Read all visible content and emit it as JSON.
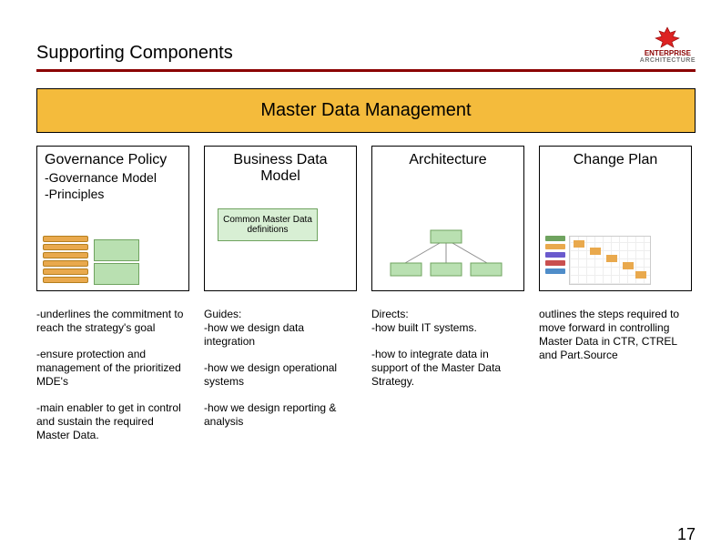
{
  "header": {
    "title": "Supporting Components",
    "logo_top": "ENTERPRISE",
    "logo_sub": "ARCHITECTURE"
  },
  "banner": "Master Data Management",
  "columns": {
    "gov": {
      "title": "Governance Policy",
      "sub1": "-Governance Model",
      "sub2": "-Principles"
    },
    "bdm": {
      "title": "Business Data Model",
      "common": "Common Master Data definitions"
    },
    "arch": {
      "title": "Architecture"
    },
    "chg": {
      "title": "Change Plan"
    }
  },
  "bullets": {
    "gov": {
      "b1": "-underlines the commitment to reach the strategy's goal",
      "b2": "-ensure protection and management of the prioritized MDE's",
      "b3": "-main enabler to get in control and sustain the required Master Data."
    },
    "bdm": {
      "b1": "Guides:",
      "b2": "-how we design data integration",
      "b3": "-how we design operational systems",
      "b4": "-how we design reporting & analysis"
    },
    "arch": {
      "b1": "Directs:",
      "b2": "-how built IT systems.",
      "b3": "-how to integrate data in support of the Master Data Strategy."
    },
    "chg": {
      "b1": "outlines the steps required to move forward in controlling Master Data in CTR, CTREL and Part.Source"
    }
  },
  "page_number": "17"
}
